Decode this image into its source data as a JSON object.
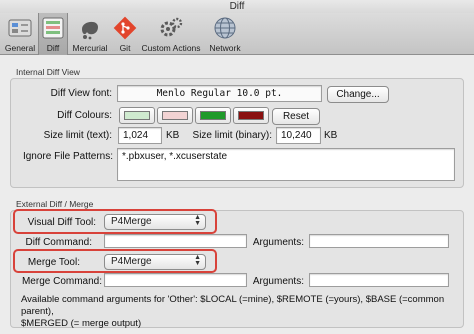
{
  "window": {
    "title": "Diff"
  },
  "toolbar": {
    "items": [
      {
        "label": "General",
        "icon": "switch-icon"
      },
      {
        "label": "Diff",
        "icon": "diff-icon",
        "selected": true
      },
      {
        "label": "Mercurial",
        "icon": "mercurial-icon"
      },
      {
        "label": "Git",
        "icon": "git-icon"
      },
      {
        "label": "Custom Actions",
        "icon": "gears-icon"
      },
      {
        "label": "Network",
        "icon": "globe-icon"
      }
    ]
  },
  "internal": {
    "section_label": "Internal Diff View",
    "font_label": "Diff View font:",
    "font_value": "Menlo Regular 10.0 pt.",
    "change_button": "Change...",
    "colours_label": "Diff Colours:",
    "colours": [
      "#cfeacf",
      "#f2d3d3",
      "#1f9a2a",
      "#8a1010"
    ],
    "reset_button": "Reset",
    "size_text_label": "Size limit (text):",
    "size_text_value": "1,024",
    "size_text_unit": "KB",
    "size_binary_label": "Size limit (binary):",
    "size_binary_value": "10,240",
    "size_binary_unit": "KB",
    "ignore_label": "Ignore File Patterns:",
    "ignore_value": "*.pbxuser, *.xcuserstate"
  },
  "external": {
    "section_label": "External Diff / Merge",
    "visual_label": "Visual Diff Tool:",
    "visual_value": "P4Merge",
    "diff_command_label": "Diff Command:",
    "diff_command_value": "",
    "diff_args_label": "Arguments:",
    "diff_args_value": "",
    "merge_label": "Merge Tool:",
    "merge_value": "P4Merge",
    "merge_command_label": "Merge Command:",
    "merge_command_value": "",
    "merge_args_label": "Arguments:",
    "merge_args_value": "",
    "note_line1": "Available command arguments for 'Other': $LOCAL (=mine), $REMOTE (=yours), $BASE (=common parent),",
    "note_line2": "$MERGED (= merge output)"
  },
  "colors": {
    "callout": "#d8423a"
  }
}
